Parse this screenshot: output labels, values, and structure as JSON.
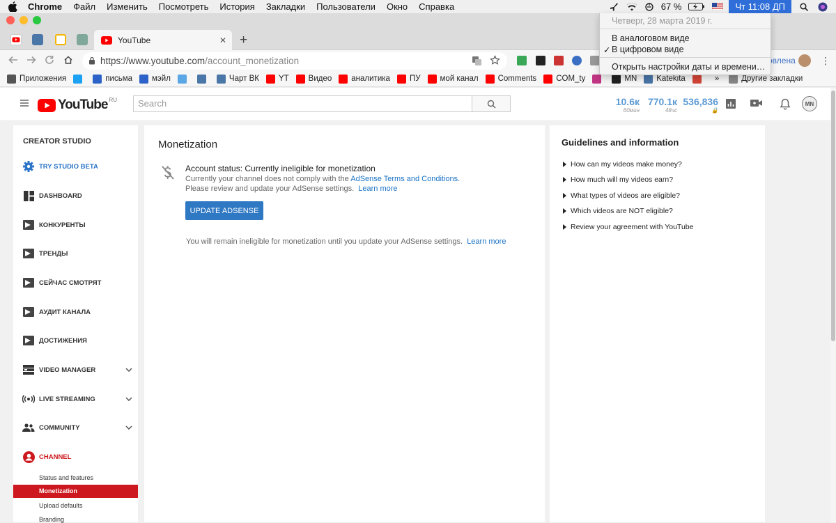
{
  "menubar": {
    "app_name": "Chrome",
    "menus": [
      "Файл",
      "Изменить",
      "Посмотреть",
      "История",
      "Закладки",
      "Пользователи",
      "Окно",
      "Справка"
    ],
    "battery": "67 %",
    "clock": "Чт 11:08 ДП"
  },
  "clock_menu": {
    "date": "Четверг, 28 марта 2019 г.",
    "analog": "В аналоговом виде",
    "digital": "В цифровом виде",
    "settings": "Открыть настройки даты и времени…",
    "checkmark": "✓"
  },
  "tab": {
    "title": "YouTube",
    "close": "✕",
    "new": "+"
  },
  "omnibox": {
    "domain": "https://www.youtube.com",
    "path": "/account_monetization"
  },
  "profile_fragment": "овлена",
  "bookmarks": {
    "items": [
      {
        "label": "Приложения",
        "color": "#555555"
      },
      {
        "label": "",
        "color": "#1da1f2"
      },
      {
        "label": "письма",
        "color": "#2d63c8"
      },
      {
        "label": "мэйл",
        "color": "#2d63c8"
      },
      {
        "label": "",
        "color": "#5ba7e6"
      },
      {
        "label": "",
        "color": "#4a76a8"
      },
      {
        "label": "Чарт ВК",
        "color": "#4a76a8"
      },
      {
        "label": "YT",
        "color": "#ff0000"
      },
      {
        "label": "Видео",
        "color": "#ff0000"
      },
      {
        "label": "аналитика",
        "color": "#ff0000"
      },
      {
        "label": "ПУ",
        "color": "#ff0000"
      },
      {
        "label": "мой канал",
        "color": "#ff0000"
      },
      {
        "label": "Comments",
        "color": "#ff0000"
      },
      {
        "label": "COM_ty",
        "color": "#ff0000"
      },
      {
        "label": "",
        "color": "#c13584"
      },
      {
        "label": "MN",
        "color": "#222222"
      },
      {
        "label": "Katekita",
        "color": "#4a76a8"
      },
      {
        "label": "",
        "color": "#d44638"
      }
    ],
    "overflow": "»",
    "other": "Другие закладки"
  },
  "youtube": {
    "logo": "YouTube",
    "region": "RU",
    "search_placeholder": "Search",
    "stats": [
      {
        "value": "10.6к",
        "sub": "60мин"
      },
      {
        "value": "770.1к",
        "sub": "48чс"
      },
      {
        "value": "536,836",
        "sub": "🔒"
      }
    ],
    "avatar": "MN"
  },
  "sidebar": {
    "title": "CREATOR STUDIO",
    "items": [
      {
        "label": "TRY STUDIO BETA",
        "icon": "gear-icon"
      },
      {
        "label": "DASHBOARD",
        "icon": "dashboard-icon"
      },
      {
        "label": "КОНКУРЕНТЫ",
        "icon": "iq-icon"
      },
      {
        "label": "ТРЕНДЫ",
        "icon": "iq-icon"
      },
      {
        "label": "СЕЙЧАС СМОТРЯТ",
        "icon": "iq-icon"
      },
      {
        "label": "АУДИТ КАНАЛА",
        "icon": "iq-icon"
      },
      {
        "label": "ДОСТИЖЕНИЯ",
        "icon": "iq-icon"
      },
      {
        "label": "VIDEO MANAGER",
        "icon": "video-manager-icon"
      },
      {
        "label": "LIVE STREAMING",
        "icon": "live-icon"
      },
      {
        "label": "COMMUNITY",
        "icon": "community-icon"
      },
      {
        "label": "CHANNEL",
        "icon": "channel-icon"
      }
    ],
    "sub_items": [
      "Status and features",
      "Monetization",
      "Upload defaults",
      "Branding"
    ]
  },
  "main": {
    "title": "Monetization",
    "status_title": "Account status: Currently ineligible for monetization",
    "line2_prefix": "Currently your channel does not comply with the ",
    "line2_link": "AdSense Terms and Conditions.",
    "line3": "Please review and update your AdSense settings.",
    "learn_more": "Learn more",
    "button": "UPDATE ADSENSE",
    "note": "You will remain ineligible for monetization until you update your AdSense settings.",
    "note_link": "Learn more"
  },
  "guidelines": {
    "title": "Guidelines and information",
    "items": [
      "How can my videos make money?",
      "How much will my videos earn?",
      "What types of videos are eligible?",
      "Which videos are NOT eligible?",
      "Review your agreement with YouTube"
    ]
  }
}
